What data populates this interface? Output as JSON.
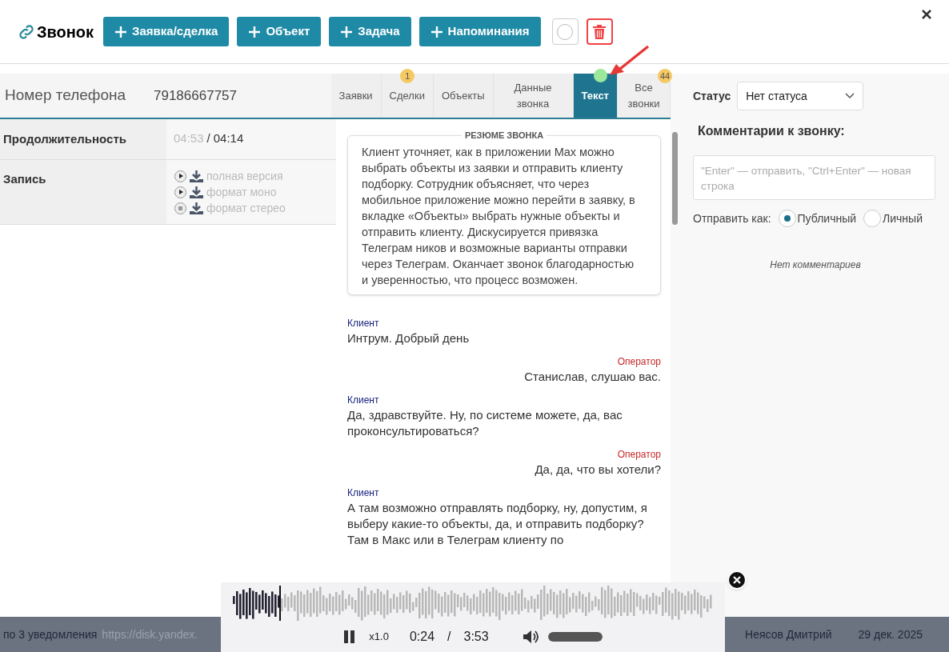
{
  "header": {
    "title": "Звонок",
    "buttons": [
      "Заявка/сделка",
      "Объект",
      "Задача",
      "Напоминания"
    ]
  },
  "phone": {
    "label": "Номер телефона",
    "value": "79186667757"
  },
  "details": {
    "duration_label": "Продолжительность",
    "duration_a": "04:53",
    "duration_sep": "/",
    "duration_b": "04:14",
    "record_label": "Запись",
    "records": [
      {
        "label": "полная версия",
        "playing": false
      },
      {
        "label": "формат моно",
        "playing": false
      },
      {
        "label": "формат стерео",
        "playing": true
      }
    ]
  },
  "tabs": [
    {
      "label": "Заявки",
      "selected": false
    },
    {
      "label": "Сделки",
      "selected": false,
      "badge": "1"
    },
    {
      "label": "Объекты",
      "selected": false
    },
    {
      "label": "Данные звонка",
      "selected": false
    },
    {
      "label": "Текст",
      "selected": true
    },
    {
      "label": "Все звонки",
      "selected": false,
      "badge": "44"
    }
  ],
  "summary": {
    "title": "РЕЗЮМЕ ЗВОНКА",
    "text": "Клиент уточняет, как в приложении Max можно выбрать объекты из заявки и отправить клиенту подборку. Сотрудник объясняет, что через мобильное приложение можно перейти в заявку, в вкладке «Объекты» выбрать нужные объекты и отправить клиенту. Дискусируется привязка Телеграм ников и возможные варианты отправки через Телеграм. Оканчает звонок благодарностью и уверенностью, что процесс возможен."
  },
  "messages": [
    {
      "kind": "client",
      "speaker": "Клиент",
      "text": "Интрум. Добрый день"
    },
    {
      "kind": "operator",
      "speaker": "Оператор",
      "text": "Станислав, слушаю вас."
    },
    {
      "kind": "client",
      "speaker": "Клиент",
      "text": "Да, здравствуйте. Ну, по системе можете, да, вас проконсультироваться?"
    },
    {
      "kind": "operator",
      "speaker": "Оператор",
      "text": "Да, да, что вы хотели?"
    },
    {
      "kind": "client",
      "speaker": "Клиент",
      "text": "А там возможно отправлять подборку, ну, допустим, я выберу какие-то объекты, да, и отправить подборку? Там в Макс или в Телеграм клиенту по"
    }
  ],
  "status": {
    "label": "Статус",
    "value": "Нет статуса"
  },
  "comments": {
    "title": "Комментарии к звонку:",
    "placeholder": "\"Enter\" — отправить, \"Ctrl+Enter\" — новая строка",
    "send_as": "Отправить как:",
    "options": [
      {
        "label": "Публичный",
        "selected": true
      },
      {
        "label": "Личный",
        "selected": false
      }
    ],
    "empty": "Нет комментариев"
  },
  "footer": {
    "text": "по 3 уведомления",
    "link": "https://disk.yandex.",
    "user": "Неясов Дмитрий",
    "date": "29 дек. 2025"
  },
  "player": {
    "speed": "x1.0",
    "current": "0:24",
    "sep": "/",
    "total": "3:53",
    "level": 0.1,
    "volume": {
      "level": 1
    }
  }
}
